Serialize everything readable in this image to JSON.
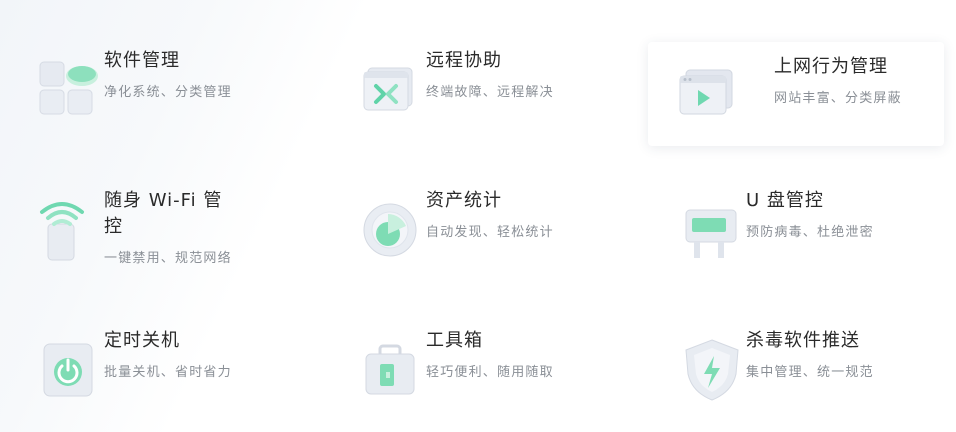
{
  "features": [
    {
      "id": "software",
      "title": "软件管理",
      "desc": "净化系统、分类管理",
      "icon": "software-management-icon"
    },
    {
      "id": "remote",
      "title": "远程协助",
      "desc": "终端故障、远程解决",
      "icon": "remote-assist-icon"
    },
    {
      "id": "internet",
      "title": "上网行为管理",
      "desc": "网站丰富、分类屏蔽",
      "icon": "internet-behavior-icon"
    },
    {
      "id": "wifi",
      "title": "随身 Wi-Fi 管控",
      "desc": "一键禁用、规范网络",
      "icon": "portable-wifi-icon"
    },
    {
      "id": "asset",
      "title": "资产统计",
      "desc": "自动发现、轻松统计",
      "icon": "asset-statistics-icon"
    },
    {
      "id": "udisk",
      "title": "U 盘管控",
      "desc": "预防病毒、杜绝泄密",
      "icon": "usb-disk-icon"
    },
    {
      "id": "shutdown",
      "title": "定时关机",
      "desc": "批量关机、省时省力",
      "icon": "scheduled-shutdown-icon"
    },
    {
      "id": "toolbox",
      "title": "工具箱",
      "desc": "轻巧便利、随用随取",
      "icon": "toolbox-icon"
    },
    {
      "id": "antivirus",
      "title": "杀毒软件推送",
      "desc": "集中管理、统一规范",
      "icon": "antivirus-push-icon"
    }
  ],
  "colors": {
    "accent": "#5fd3a8",
    "icon_base": "#e4e8f0",
    "title": "#2a2a2a",
    "desc": "#8a8f96"
  }
}
